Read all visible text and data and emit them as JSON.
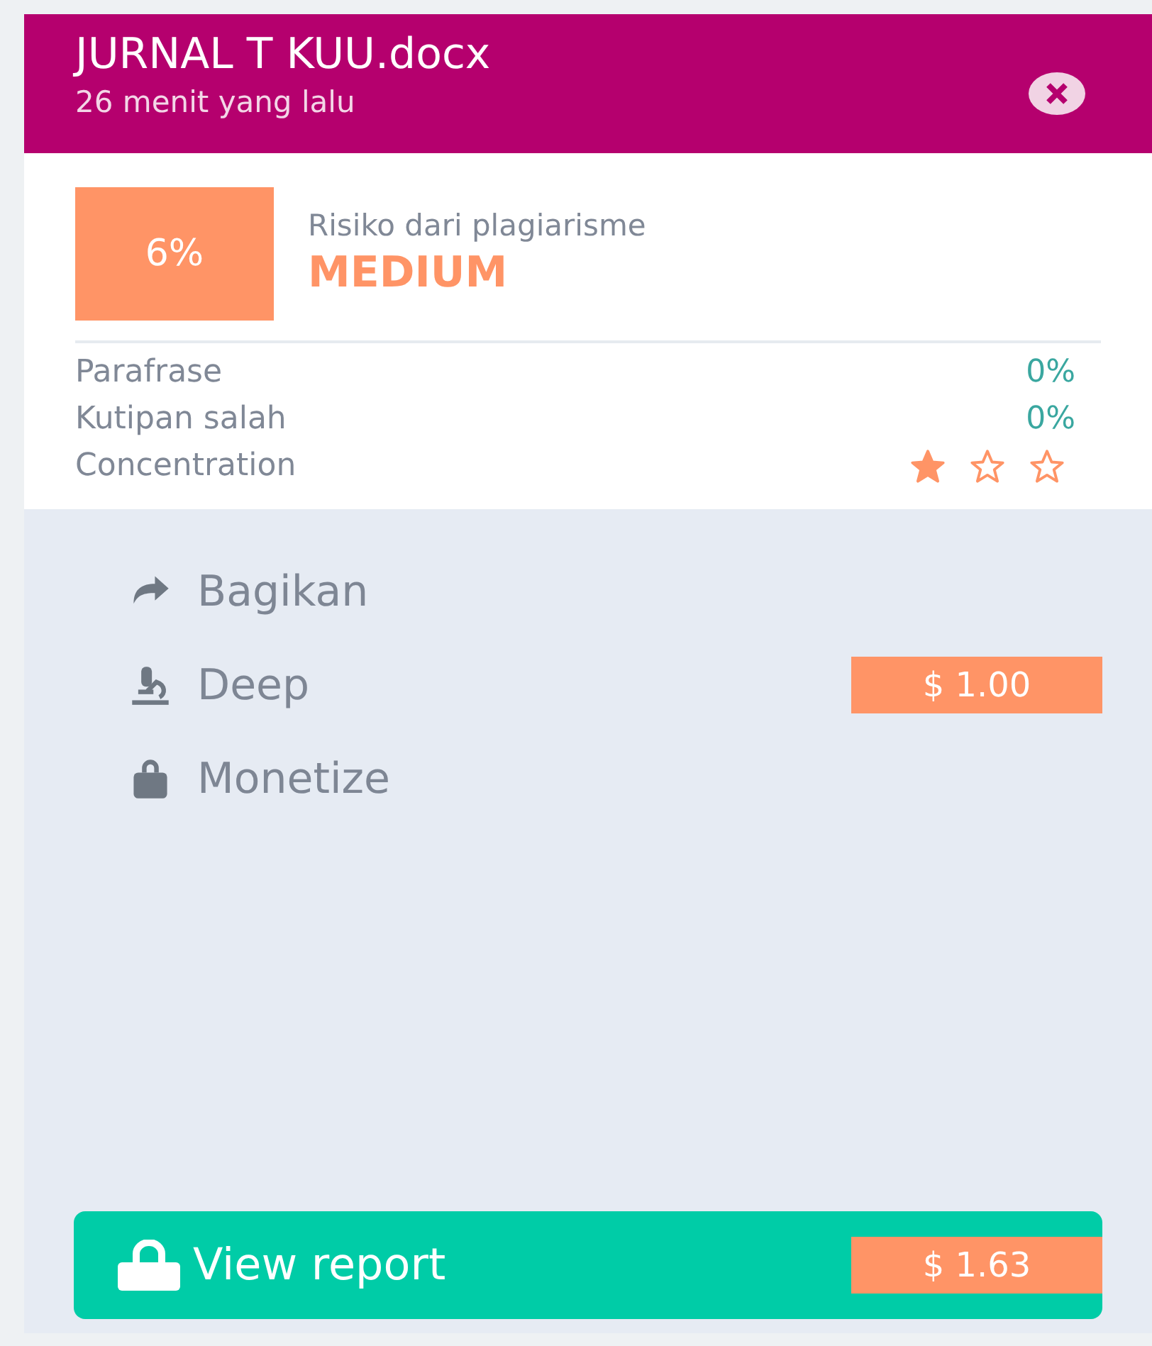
{
  "header": {
    "title": "JURNAL T KUU.docx",
    "subtitle": "26 menit yang lalu"
  },
  "risk": {
    "percent": "6%",
    "label": "Risiko dari plagiarisme",
    "level_text": "MEDIUM",
    "color": "#ff9466"
  },
  "metrics": [
    {
      "kind": "text",
      "label": "Parafrase",
      "value": "0%"
    },
    {
      "kind": "text",
      "label": "Kutipan salah",
      "value": "0%"
    },
    {
      "kind": "stars",
      "label": "Concentration",
      "stars": 1
    }
  ],
  "actions": [
    {
      "kind": "share",
      "label": "Bagikan"
    },
    {
      "kind": "deep",
      "label": "Deep",
      "price": "$ 1.00"
    },
    {
      "kind": "monetize",
      "label": "Monetize"
    }
  ],
  "report_button": {
    "label": "View report",
    "price": "$ 1.63"
  }
}
